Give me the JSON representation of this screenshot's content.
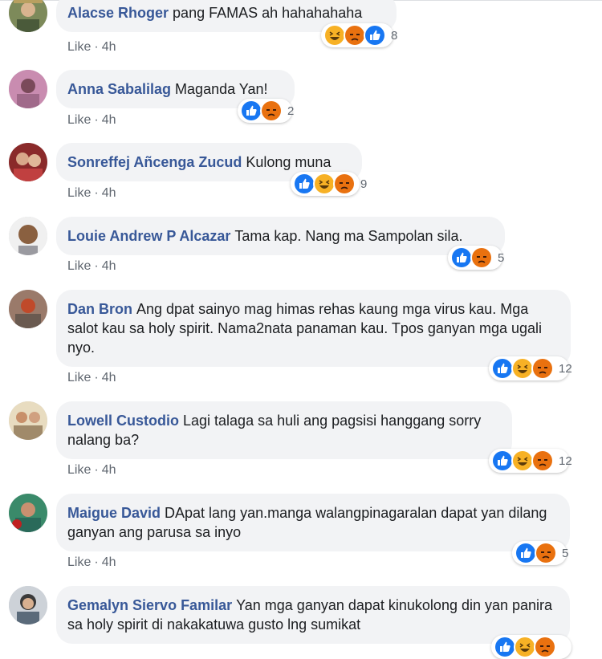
{
  "comments": [
    {
      "author": "Alacse Rhoger",
      "text": "pang FAMAS ah hahahahaha",
      "like": "Like",
      "sep": "·",
      "time": "4h",
      "count": "8",
      "reactions": [
        "haha-icon",
        "angry-icon",
        "like-icon"
      ]
    },
    {
      "author": "Anna Sabalilag",
      "text": "Maganda Yan!",
      "like": "Like",
      "sep": "·",
      "time": "4h",
      "count": "2",
      "reactions": [
        "like-icon",
        "angry-icon"
      ]
    },
    {
      "author": "Sonreffej Añcenga Zucud",
      "text": "Kulong muna",
      "like": "Like",
      "sep": "·",
      "time": "4h",
      "count": "9",
      "reactions": [
        "like-icon",
        "haha-icon",
        "angry-icon"
      ]
    },
    {
      "author": "Louie Andrew P Alcazar",
      "text": "Tama kap. Nang ma Sampolan sila.",
      "like": "Like",
      "sep": "·",
      "time": "4h",
      "count": "5",
      "reactions": [
        "like-icon",
        "angry-icon"
      ]
    },
    {
      "author": "Dan Bron",
      "text": "Ang dpat sainyo mag himas rehas kaung mga virus kau. Mga salot kau sa holy spirit. Nama2nata panaman kau. Tpos ganyan mga ugali nyo.",
      "like": "Like",
      "sep": "·",
      "time": "4h",
      "count": "12",
      "reactions": [
        "like-icon",
        "haha-icon",
        "angry-icon"
      ]
    },
    {
      "author": "Lowell Custodio",
      "text": "Lagi talaga sa huli ang pagsisi hanggang sorry nalang ba?",
      "like": "Like",
      "sep": "·",
      "time": "4h",
      "count": "12",
      "reactions": [
        "like-icon",
        "haha-icon",
        "angry-icon"
      ]
    },
    {
      "author": "Maigue David",
      "text": "DApat lang yan.manga walangpinagaralan dapat yan dilang ganyan ang parusa sa inyo",
      "like": "Like",
      "sep": "·",
      "time": "4h",
      "count": "5",
      "reactions": [
        "like-icon",
        "angry-icon"
      ]
    },
    {
      "author": "Gemalyn Siervo Familar",
      "text": "Yan mga ganyan dapat kinukolong din yan panira sa holy spirit di nakakatuwa gusto lng sumikat",
      "like": "",
      "sep": "",
      "time": "",
      "count": "",
      "reactions": [
        "like-icon",
        "haha-icon",
        "angry-icon"
      ]
    }
  ],
  "colors": {
    "author": "#385898",
    "bubble": "#f2f3f5",
    "like_blue": "#1877f2",
    "angry": "#e9710f",
    "haha": "#f7b125"
  }
}
